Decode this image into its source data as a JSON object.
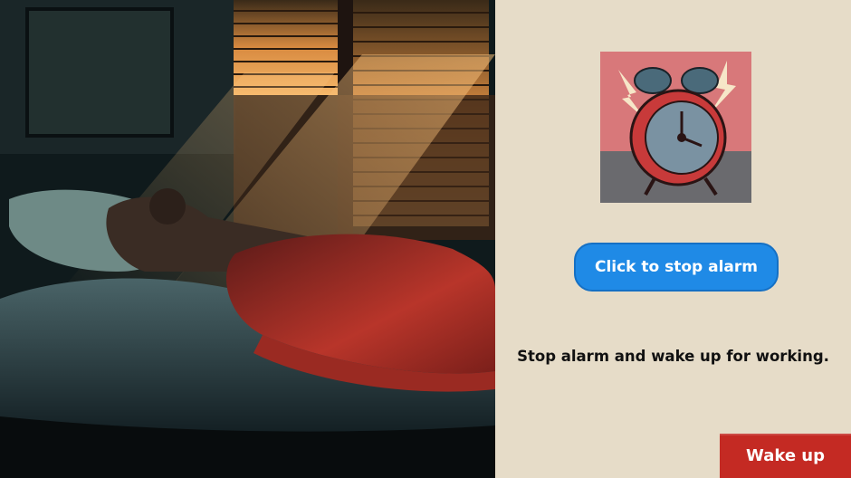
{
  "scene": {
    "illustration_icon": "sleeping-person-bedroom-illustration",
    "colors": {
      "dark": "#0d1416",
      "sunlight": "#f0a050",
      "blanket": "#b8352a"
    }
  },
  "panel": {
    "background": "#e6dcc8",
    "clock_icon": "alarm-clock-icon",
    "stop_button_label": "Click to stop alarm",
    "stop_button_color": "#1f8ae6",
    "instruction": "Stop alarm and wake up for working."
  },
  "footer": {
    "wake_button_label": "Wake up",
    "wake_button_color": "#c42a23"
  }
}
